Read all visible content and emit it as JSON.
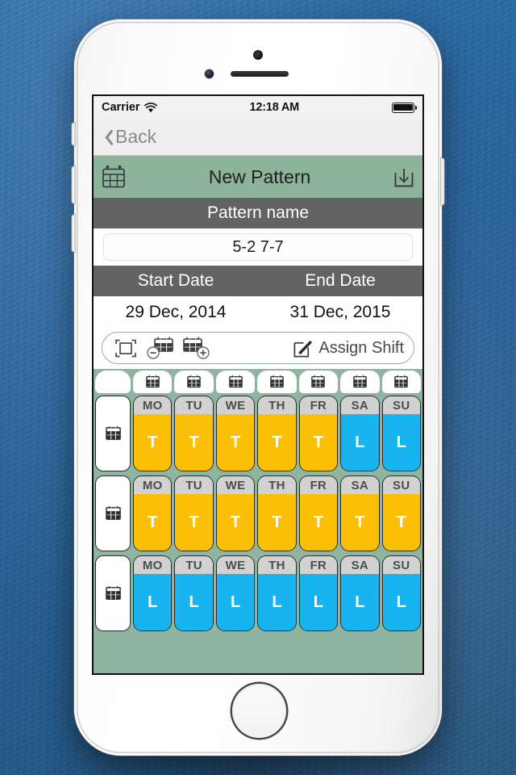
{
  "status_bar": {
    "carrier": "Carrier",
    "wifi_icon": "wifi-icon",
    "time": "12:18 AM",
    "battery_icon": "battery-full-icon"
  },
  "nav_bar": {
    "back_label": "Back",
    "back_icon": "chevron-left-icon"
  },
  "header": {
    "calendar_icon": "calendar-icon",
    "title": "New Pattern",
    "save_icon": "save-download-icon"
  },
  "pattern_name": {
    "section_label": "Pattern name",
    "value": "5-2 7-7",
    "placeholder": "Pattern name"
  },
  "dates": {
    "start_label": "Start Date",
    "end_label": "End Date",
    "start_value": "29 Dec, 2014",
    "end_value": "31 Dec, 2015"
  },
  "toolbar": {
    "select_all_icon": "select-all-icon",
    "remove_week_icon": "calendar-minus-icon",
    "add_week_icon": "calendar-plus-icon",
    "assign_icon": "edit-pencil-icon",
    "assign_label": "Assign Shift"
  },
  "grid": {
    "column_header_icon": "calendar-column-icon",
    "row_header_icon": "calendar-row-icon",
    "day_labels": [
      "MO",
      "TU",
      "WE",
      "TH",
      "FR",
      "SA",
      "SU"
    ],
    "shift_colors": {
      "T": "#fbbf05",
      "L": "#17b4ef",
      "day_label_bg": "#d2d2d2"
    },
    "weeks": [
      {
        "row": 1,
        "shifts": [
          "T",
          "T",
          "T",
          "T",
          "T",
          "L",
          "L"
        ]
      },
      {
        "row": 2,
        "shifts": [
          "T",
          "T",
          "T",
          "T",
          "T",
          "T",
          "T"
        ]
      },
      {
        "row": 3,
        "shifts": [
          "L",
          "L",
          "L",
          "L",
          "L",
          "L",
          "L"
        ]
      }
    ]
  },
  "theme": {
    "green": "#8db39b",
    "grid_bg": "#8fb4a0",
    "gray_bar": "#636363",
    "orange": "#fbbf05",
    "blue": "#17b4ef",
    "wallpaper_blue": "#2a6399"
  }
}
